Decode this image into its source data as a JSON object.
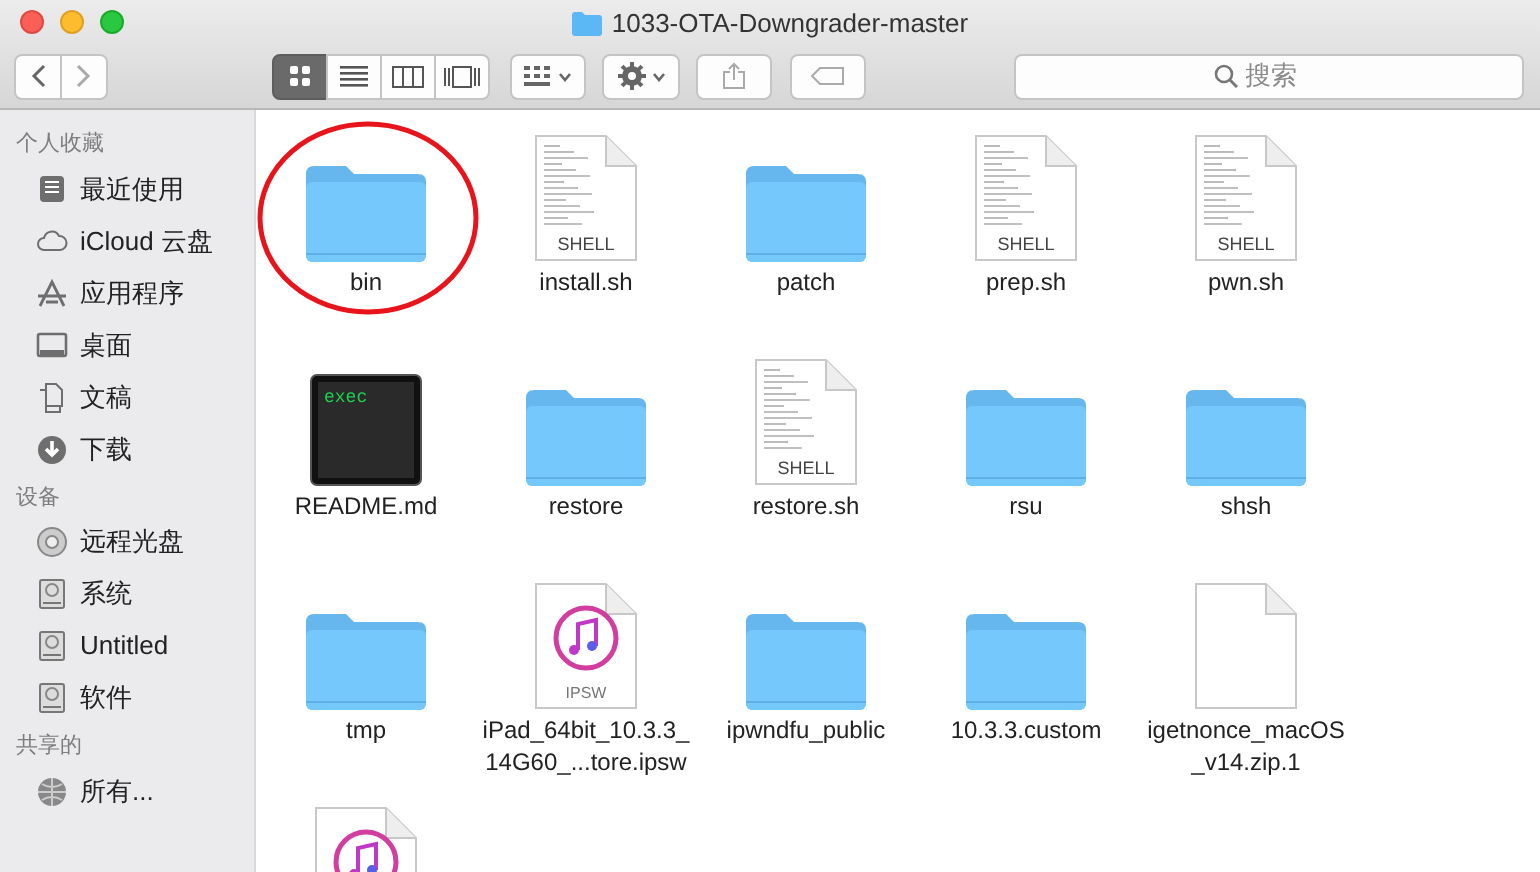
{
  "window": {
    "title": "1033-OTA-Downgrader-master"
  },
  "toolbar": {
    "view_modes": [
      {
        "kind": "icon",
        "selected": true
      },
      {
        "kind": "list",
        "selected": false
      },
      {
        "kind": "column",
        "selected": false
      },
      {
        "kind": "coverflow",
        "selected": false
      }
    ],
    "search": {
      "placeholder": "搜索"
    }
  },
  "sidebar": {
    "sections": [
      {
        "title": "个人收藏",
        "items": [
          {
            "label": "最近使用",
            "kind": "recent"
          },
          {
            "label": "iCloud 云盘",
            "kind": "cloud"
          },
          {
            "label": "应用程序",
            "kind": "apps"
          },
          {
            "label": "桌面",
            "kind": "desktop"
          },
          {
            "label": "文稿",
            "kind": "docs"
          },
          {
            "label": "下载",
            "kind": "download"
          }
        ]
      },
      {
        "title": "设备",
        "items": [
          {
            "label": "远程光盘",
            "kind": "disc"
          },
          {
            "label": "系统",
            "kind": "drive"
          },
          {
            "label": "Untitled",
            "kind": "drive"
          },
          {
            "label": "软件",
            "kind": "drive"
          }
        ]
      },
      {
        "title": "共享的",
        "items": [
          {
            "label": "所有...",
            "kind": "network"
          }
        ]
      }
    ]
  },
  "files": [
    {
      "name": "bin",
      "kind": "folder",
      "circled": true
    },
    {
      "name": "install.sh",
      "kind": "shell",
      "badge": "SHELL",
      "circled": false
    },
    {
      "name": "patch",
      "kind": "folder",
      "circled": false
    },
    {
      "name": "prep.sh",
      "kind": "shell",
      "badge": "SHELL",
      "circled": false
    },
    {
      "name": "pwn.sh",
      "kind": "shell",
      "badge": "SHELL",
      "circled": false
    },
    {
      "name": "README.md",
      "kind": "exec",
      "circled": false
    },
    {
      "name": "restore",
      "kind": "folder",
      "circled": false
    },
    {
      "name": "restore.sh",
      "kind": "shell",
      "badge": "SHELL",
      "circled": false
    },
    {
      "name": "rsu",
      "kind": "folder",
      "circled": false
    },
    {
      "name": "shsh",
      "kind": "folder",
      "circled": false
    },
    {
      "name": "tmp",
      "kind": "folder",
      "circled": false
    },
    {
      "name": "iPad_64bit_10.3.3_14G60_...tore.ipsw",
      "kind": "ipsw",
      "badge": "IPSW",
      "circled": false
    },
    {
      "name": "ipwndfu_public",
      "kind": "folder",
      "circled": false
    },
    {
      "name": "10.3.3.custom",
      "kind": "folder",
      "circled": false
    },
    {
      "name": "igetnonce_macOS_v14.zip.1",
      "kind": "blank",
      "circled": false
    },
    {
      "kind": "ipsw",
      "circled": false
    }
  ]
}
